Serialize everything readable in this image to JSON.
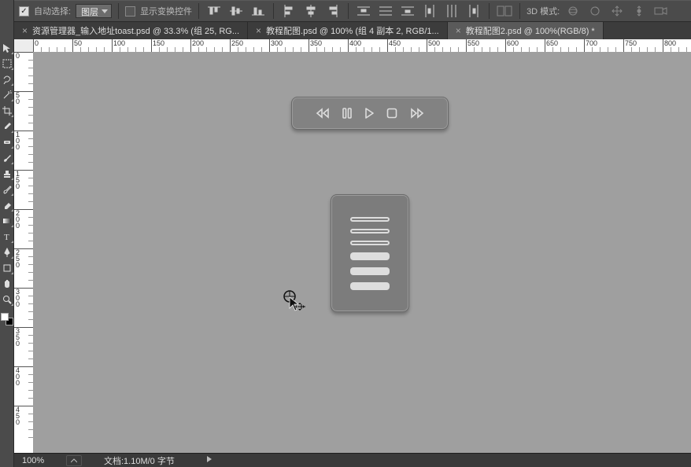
{
  "options": {
    "autoSelectLabel": "自动选择:",
    "autoSelectChecked": true,
    "layerSelector": "图层",
    "showTransformLabel": "显示变换控件",
    "showTransformChecked": false,
    "mode3DLabel": "3D 模式:"
  },
  "tabs": [
    {
      "title": "资源管理器_输入地址toast.psd @ 33.3% (组 25, RG...",
      "active": false
    },
    {
      "title": "教程配图.psd @ 100% (组 4 副本 2, RGB/1...",
      "active": false
    },
    {
      "title": "教程配图2.psd @ 100%(RGB/8) *",
      "active": true
    }
  ],
  "rulerH": [
    0,
    50,
    100,
    150,
    200,
    250,
    300,
    350,
    400,
    450,
    500,
    550,
    600,
    650,
    700,
    750,
    800
  ],
  "rulerV": [
    0,
    50,
    100,
    150,
    200,
    250,
    300,
    350,
    400,
    450
  ],
  "status": {
    "zoom": "100%",
    "docInfo": "文档:1.10M/0 字节"
  },
  "tools": [
    "move",
    "marquee",
    "lasso",
    "wand",
    "crop",
    "eyedropper",
    "heal",
    "brush",
    "stamp",
    "history",
    "eraser",
    "gradient",
    "blur",
    "dodge",
    "pen",
    "type",
    "path",
    "rect",
    "hand",
    "zoom"
  ],
  "icons": {
    "alignGroup1": [
      "align-left-edges",
      "align-h-centers",
      "align-right-edges"
    ],
    "alignGroup2": [
      "align-top-edges",
      "align-v-centers",
      "align-bottom-edges"
    ],
    "distGroup": [
      "dist-left",
      "dist-h-center",
      "dist-right",
      "dist-top",
      "dist-v-center",
      "dist-bottom"
    ],
    "autoAlign": "auto-align",
    "mode3d": [
      "orbit-3d",
      "roll-3d",
      "pan-3d",
      "slide-3d",
      "camera-3d"
    ]
  },
  "playback": [
    "rewind",
    "pause",
    "play",
    "stop",
    "forward"
  ],
  "listRows": [
    "outline",
    "outline",
    "outline",
    "fill",
    "fill",
    "fill"
  ]
}
